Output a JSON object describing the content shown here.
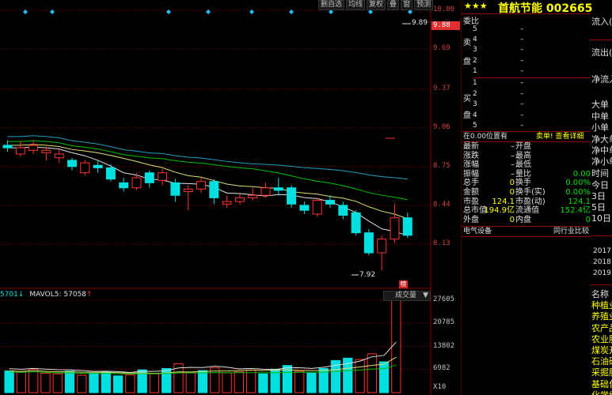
{
  "toolbar": [
    "删自选",
    "均线",
    "复权",
    "叠",
    "窗",
    "预测"
  ],
  "price_axis": [
    "10.00",
    "9.69",
    "9.37",
    "9.06",
    "8.75",
    "8.44",
    "8.13"
  ],
  "price_axis_highlight": "9.88",
  "vol_axis": [
    "27605",
    "20785",
    "13802",
    "6982",
    "X10"
  ],
  "annotations": {
    "high": "9.89",
    "low": "7.92",
    "flag": "榜"
  },
  "vol_header": {
    "left": "5701",
    "mavol5": "MAVOL5: 57058",
    "title": "成交量"
  },
  "stars": "★★★",
  "stock_title": "首航节能 002665",
  "order_book": {
    "ratio_label": "委比",
    "sell_label": [
      "卖",
      "盘"
    ],
    "buy_label": [
      "买",
      "盘"
    ],
    "sell_levels": [
      "5",
      "4",
      "3",
      "2",
      "1"
    ],
    "buy_levels": [
      "1",
      "2",
      "3",
      "4",
      "5"
    ],
    "dash": "–"
  },
  "status_bar": {
    "left": "在0.00位置有",
    "right": "卖单! 查看详细"
  },
  "quote": [
    {
      "l": "最新",
      "lv": "–",
      "m": "开盘",
      "mv": ""
    },
    {
      "l": "涨跌",
      "lv": "–",
      "m": "最高",
      "mv": ""
    },
    {
      "l": "涨幅",
      "lv": "–",
      "m": "最低",
      "mv": ""
    },
    {
      "l": "振幅",
      "lv": "–",
      "m": "量比",
      "mv": "0.00"
    },
    {
      "l": "总手",
      "lv": "0",
      "m": "换手",
      "mv": "0.00%"
    },
    {
      "l": "金额",
      "lv": "0",
      "m": "换手(实)",
      "mv": "0.00%"
    },
    {
      "l": "市盈",
      "lv": "124.1",
      "m": "市盈(动)",
      "mv": "124.1"
    },
    {
      "l": "总市值",
      "lv": "194.9亿",
      "m": "流通值",
      "mv": "152.4亿"
    },
    {
      "l": "外盘",
      "lv": "0",
      "m": "内盘",
      "mv": "0"
    }
  ],
  "industry": {
    "left": "电气设备",
    "right": "同行业比较"
  },
  "far_right": [
    "流入(",
    "流出(",
    "净流入",
    "大单",
    "中单",
    "小单",
    "净大单",
    "净中单",
    "净小单",
    "时间",
    "今日",
    "3日",
    "5日",
    "10日"
  ],
  "far_right_years": [
    "2017",
    "2018",
    "2019"
  ],
  "far_right_list": [
    "名称",
    "种植业",
    "养殖业",
    "农产品",
    "农业服",
    "煤炭开",
    "石油矿",
    "采掘服",
    "基础化",
    "化学纤"
  ],
  "colors": {
    "up": "#ff3333",
    "down": "#00e0e0",
    "grid": "#8a0000",
    "ma5": "#e0e0e0",
    "ma10": "#e0e070",
    "ma20": "#00c000",
    "ma60": "#20a0c0"
  },
  "chart_data": {
    "type": "candlestick",
    "ylim": [
      7.82,
      10.0
    ],
    "candles": [
      {
        "o": 8.92,
        "c": 8.9,
        "h": 8.96,
        "l": 8.87
      },
      {
        "o": 8.85,
        "c": 8.9,
        "h": 8.95,
        "l": 8.83
      },
      {
        "o": 8.88,
        "c": 8.92,
        "h": 8.96,
        "l": 8.85
      },
      {
        "o": 8.86,
        "c": 8.88,
        "h": 8.91,
        "l": 8.8
      },
      {
        "o": 8.82,
        "c": 8.85,
        "h": 8.89,
        "l": 8.78
      },
      {
        "o": 8.8,
        "c": 8.75,
        "h": 8.82,
        "l": 8.72
      },
      {
        "o": 8.7,
        "c": 8.78,
        "h": 8.8,
        "l": 8.68
      },
      {
        "o": 8.76,
        "c": 8.74,
        "h": 8.8,
        "l": 8.7
      },
      {
        "o": 8.74,
        "c": 8.65,
        "h": 8.77,
        "l": 8.63
      },
      {
        "o": 8.62,
        "c": 8.58,
        "h": 8.66,
        "l": 8.55
      },
      {
        "o": 8.58,
        "c": 8.66,
        "h": 8.7,
        "l": 8.56
      },
      {
        "o": 8.7,
        "c": 8.62,
        "h": 8.72,
        "l": 8.58
      },
      {
        "o": 8.64,
        "c": 8.7,
        "h": 8.73,
        "l": 8.6
      },
      {
        "o": 8.62,
        "c": 8.52,
        "h": 8.65,
        "l": 8.47
      },
      {
        "o": 8.55,
        "c": 8.57,
        "h": 8.6,
        "l": 8.4
      },
      {
        "o": 8.57,
        "c": 8.63,
        "h": 8.66,
        "l": 8.54
      },
      {
        "o": 8.63,
        "c": 8.5,
        "h": 8.65,
        "l": 8.45
      },
      {
        "o": 8.45,
        "c": 8.47,
        "h": 8.52,
        "l": 8.42
      },
      {
        "o": 8.47,
        "c": 8.5,
        "h": 8.53,
        "l": 8.45
      },
      {
        "o": 8.5,
        "c": 8.52,
        "h": 8.58,
        "l": 8.48
      },
      {
        "o": 8.52,
        "c": 8.58,
        "h": 8.62,
        "l": 8.5
      },
      {
        "o": 8.58,
        "c": 8.56,
        "h": 8.66,
        "l": 8.52
      },
      {
        "o": 8.58,
        "c": 8.45,
        "h": 8.6,
        "l": 8.42
      },
      {
        "o": 8.44,
        "c": 8.4,
        "h": 8.47,
        "l": 8.37
      },
      {
        "o": 8.37,
        "c": 8.48,
        "h": 8.5,
        "l": 8.35
      },
      {
        "o": 8.48,
        "c": 8.45,
        "h": 8.52,
        "l": 8.42
      },
      {
        "o": 8.44,
        "c": 8.36,
        "h": 8.47,
        "l": 8.33
      },
      {
        "o": 8.38,
        "c": 8.22,
        "h": 8.4,
        "l": 8.2
      },
      {
        "o": 8.22,
        "c": 8.06,
        "h": 8.25,
        "l": 8.04
      },
      {
        "o": 8.06,
        "c": 8.17,
        "h": 8.2,
        "l": 7.92
      },
      {
        "o": 8.17,
        "c": 8.34,
        "h": 8.45,
        "l": 8.14
      },
      {
        "o": 8.34,
        "c": 8.2,
        "h": 8.38,
        "l": 8.18
      }
    ],
    "volume_ylim": [
      0,
      27605
    ],
    "volumes": [
      6500,
      6200,
      7000,
      5800,
      5600,
      6400,
      5200,
      5800,
      6100,
      5000,
      5300,
      6800,
      5600,
      7200,
      8600,
      6100,
      6600,
      7400,
      5900,
      6200,
      6700,
      5600,
      7000,
      8100,
      6400,
      5800,
      7200,
      9600,
      10300,
      9900,
      11600,
      9200,
      27605
    ]
  }
}
